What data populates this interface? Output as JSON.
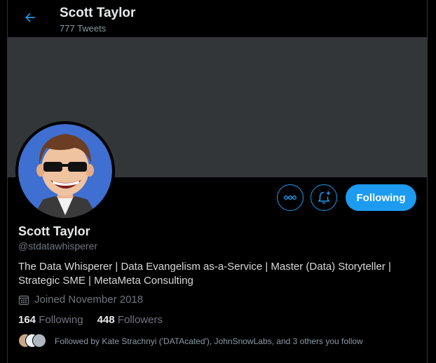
{
  "header": {
    "name": "Scott Taylor",
    "tweet_count": "777 Tweets"
  },
  "actions": {
    "follow_label": "Following"
  },
  "profile": {
    "display_name": "Scott Taylor",
    "handle": "@stdatawhisperer",
    "bio_line1": "The Data Whisperer | Data Evangelism as-a-Service | Master (Data) Storyteller |",
    "bio_line2": "Strategic SME | MetaMeta Consulting",
    "joined": "Joined November 2018"
  },
  "stats": {
    "following_count": "164",
    "following_label": "Following",
    "followers_count": "448",
    "followers_label": "Followers"
  },
  "followed_by": {
    "text": "Followed by Kate Strachnyi ('DATAcated'), JohnSnowLabs, and 3 others you follow"
  },
  "colors": {
    "accent": "#1d9bf0",
    "background": "#000000",
    "banner": "#333639",
    "muted_text": "#6e767d"
  }
}
